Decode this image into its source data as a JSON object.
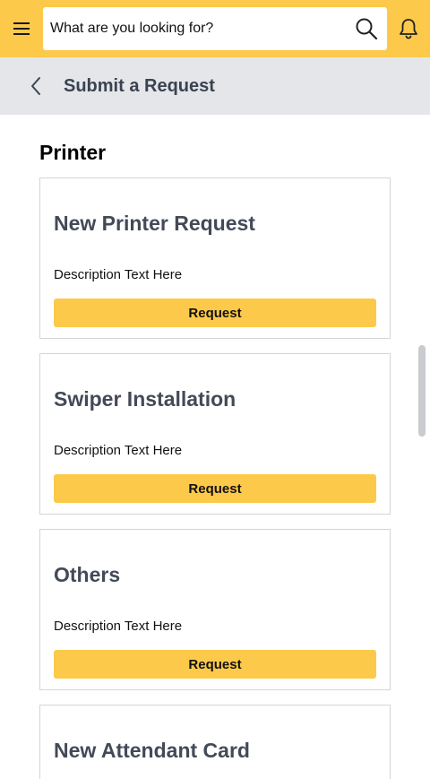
{
  "topbar": {
    "menu_icon": "hamburger-menu-icon",
    "search_placeholder": "What are you looking for?",
    "search_icon": "search-icon",
    "notification_icon": "bell-icon",
    "accent_color": "#fdc94a"
  },
  "subheader": {
    "back_icon": "chevron-left-icon",
    "title": "Submit a Request"
  },
  "section": {
    "title": "Printer"
  },
  "cards": [
    {
      "title": "New Printer Request",
      "description": "Description Text Here",
      "button_label": "Request"
    },
    {
      "title": "Swiper Installation",
      "description": "Description Text Here",
      "button_label": "Request"
    },
    {
      "title": "Others",
      "description": "Description Text Here",
      "button_label": "Request"
    },
    {
      "title": "New Attendant Card"
    }
  ]
}
